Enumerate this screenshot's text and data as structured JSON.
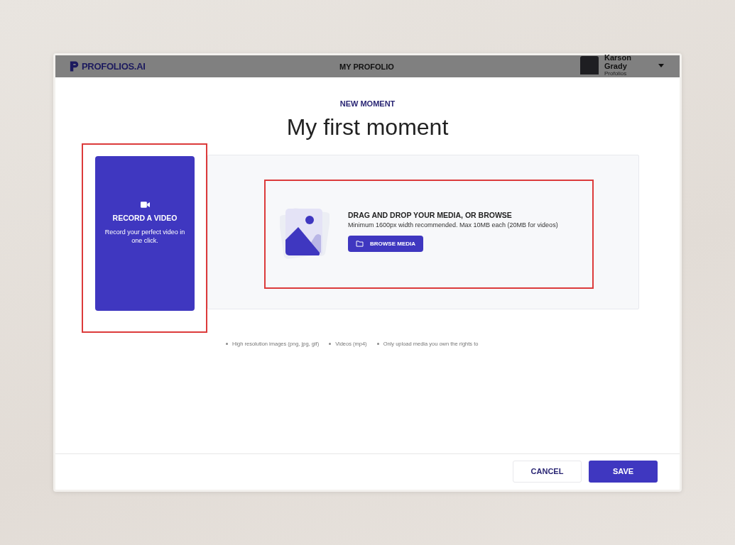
{
  "header": {
    "logo": "PROFOLIOS.AI",
    "title": "MY PROFOLIO",
    "user": {
      "name": "Karson Grady",
      "subtitle": "Profolios"
    }
  },
  "eyebrow": "NEW MOMENT",
  "title": "My first moment",
  "record_video": {
    "title": "RECORD A VIDEO",
    "description": "Record your perfect video in one click.",
    "highlighted": true
  },
  "dropzone": {
    "title": "DRAG AND DROP YOUR MEDIA, OR BROWSE",
    "description": "Minimum 1600px width recommended. Max 10MB each (20MB for videos)",
    "button": "BROWSE MEDIA",
    "highlighted": true
  },
  "hints": [
    "High resolution images (png, jpg, gif)",
    "Videos (mp4)",
    "Only upload media you own the rights to"
  ],
  "footer": {
    "buttons": [
      {
        "label": "CANCEL",
        "kind": "secondary"
      },
      {
        "label": "SAVE",
        "kind": "primary"
      }
    ]
  }
}
